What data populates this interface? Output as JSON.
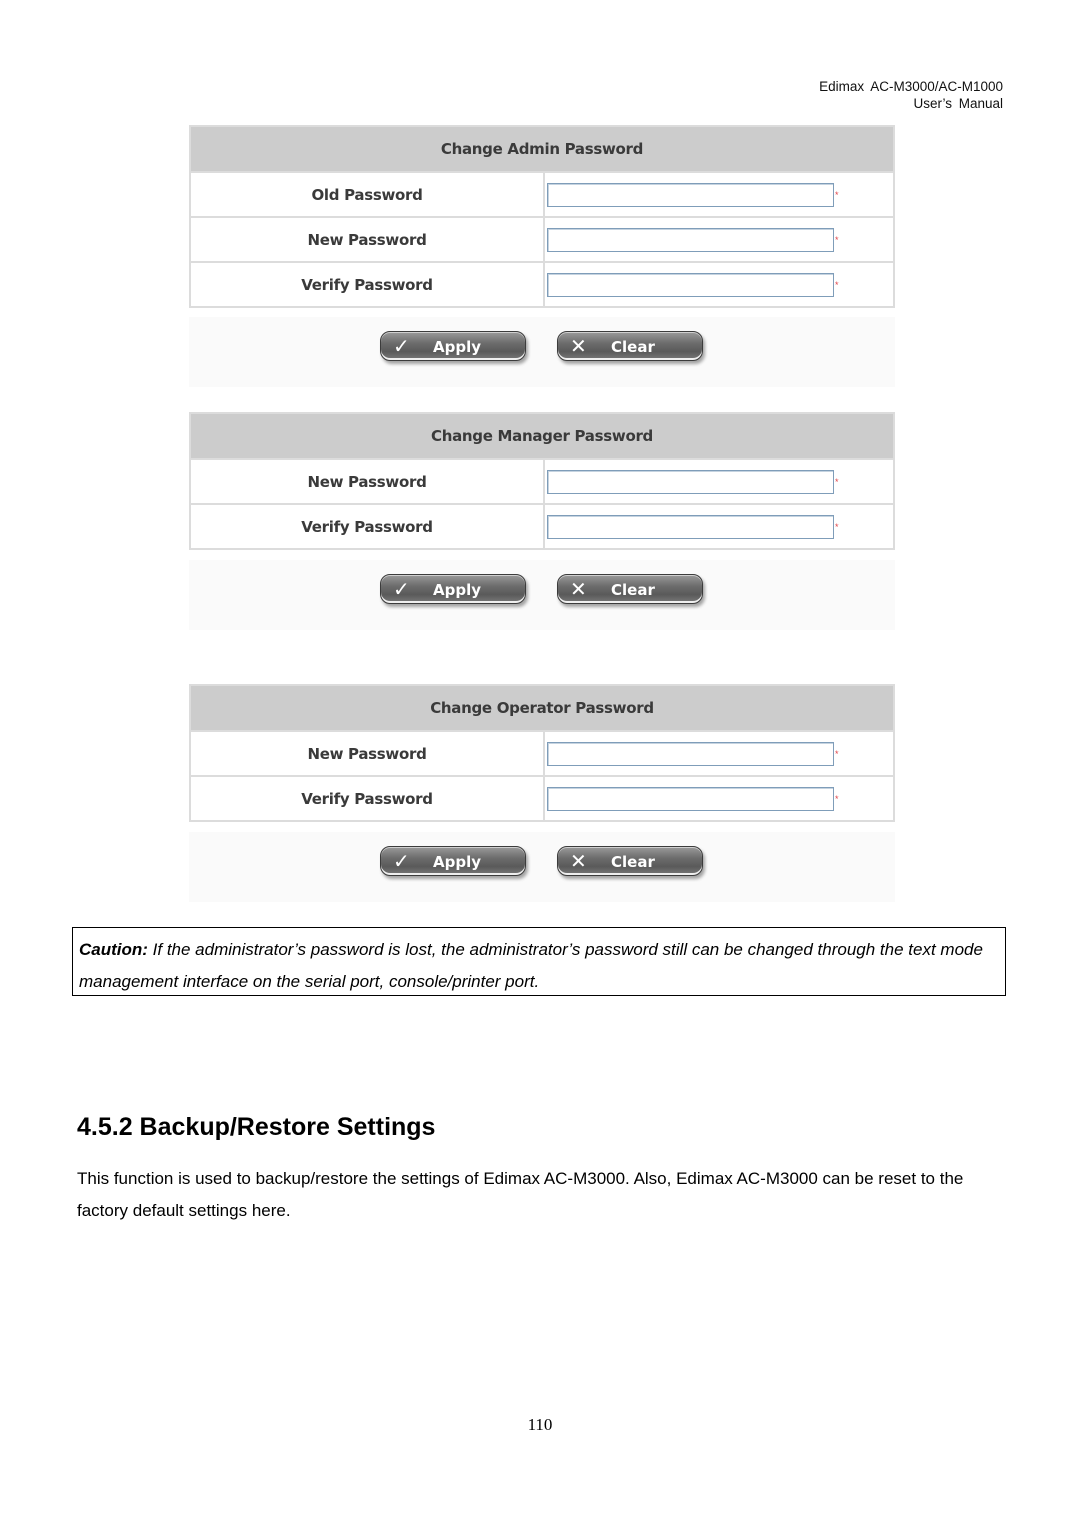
{
  "header": {
    "line1": "Edimax  AC-M3000/AC-M1000",
    "line2": "User’s  Manual"
  },
  "forms": [
    {
      "title": "Change Admin Password",
      "fields": [
        {
          "label": "Old Password",
          "value": "",
          "required_mark": "*"
        },
        {
          "label": "New Password",
          "value": "",
          "required_mark": "*"
        },
        {
          "label": "Verify Password",
          "value": "",
          "required_mark": "*"
        }
      ],
      "buttons": {
        "apply": "Apply",
        "clear": "Clear"
      }
    },
    {
      "title": "Change Manager Password",
      "fields": [
        {
          "label": "New Password",
          "value": "",
          "required_mark": "*"
        },
        {
          "label": "Verify Password",
          "value": "",
          "required_mark": "*"
        }
      ],
      "buttons": {
        "apply": "Apply",
        "clear": "Clear"
      }
    },
    {
      "title": "Change Operator Password",
      "fields": [
        {
          "label": "New Password",
          "value": "",
          "required_mark": "*"
        },
        {
          "label": "Verify Password",
          "value": "",
          "required_mark": "*"
        }
      ],
      "buttons": {
        "apply": "Apply",
        "clear": "Clear"
      }
    }
  ],
  "icons": {
    "apply": "checkmark-icon",
    "clear": "x-icon",
    "apply_glyph": "✓",
    "clear_glyph": "✕"
  },
  "caution": {
    "label": "Caution:",
    "text": " If the administrator’s password is lost, the administrator’s password still can be changed through the text mode management interface on the serial port, console/printer port."
  },
  "section": {
    "title": "4.5.2 Backup/Restore Settings",
    "body": "This function is used to backup/restore the settings of Edimax AC-M3000. Also, Edimax AC-M3000 can be reset to the factory default settings here."
  },
  "page_number": "110",
  "colors": {
    "table_header_bg": "#cccccc",
    "table_border": "#dcdcdc",
    "input_border": "#7f9db9",
    "required_mark": "#e0454a",
    "button_bg": "#6c6c6c"
  }
}
